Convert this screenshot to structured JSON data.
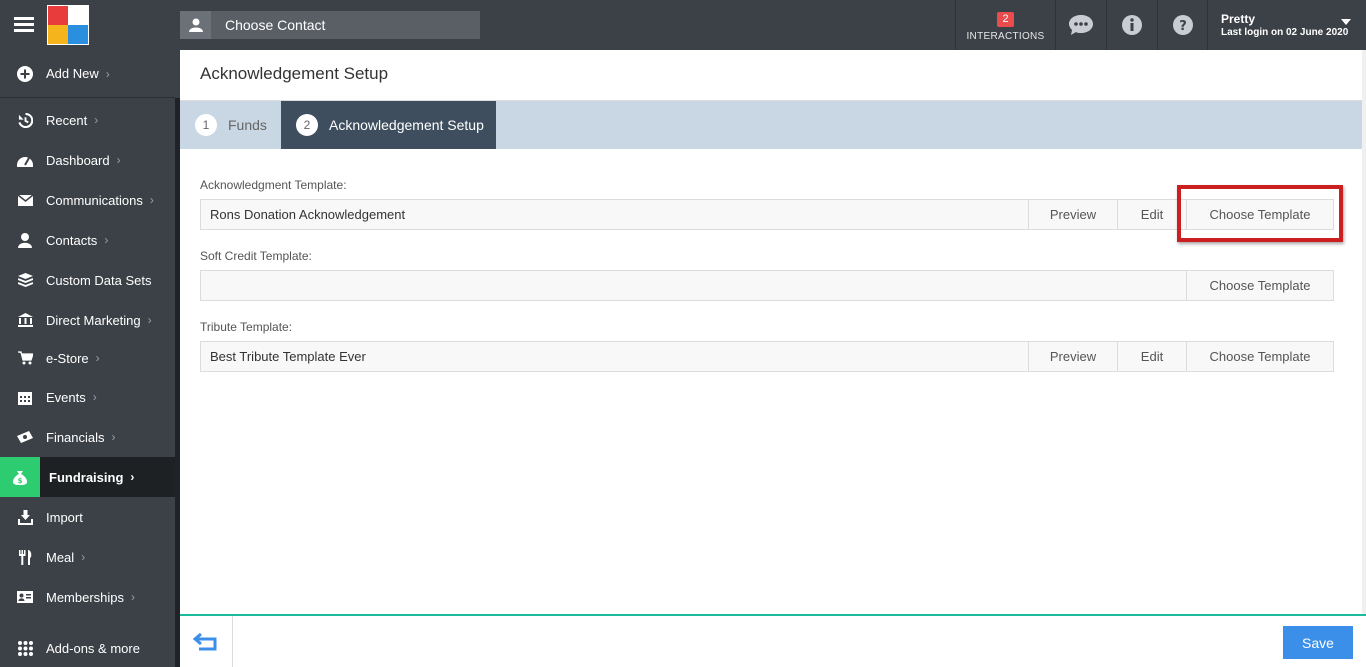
{
  "header": {
    "contact_placeholder": "Choose Contact",
    "interactions_count": "2",
    "interactions_label": "INTERACTIONS",
    "user_name": "Pretty",
    "last_login": "Last login on 02 June 2020"
  },
  "sidebar": {
    "add_new": "Add New",
    "items": [
      {
        "label": "Recent",
        "icon": "history-icon"
      },
      {
        "label": "Dashboard",
        "icon": "dashboard-icon"
      },
      {
        "label": "Communications",
        "icon": "envelope-icon"
      },
      {
        "label": "Contacts",
        "icon": "user-icon"
      },
      {
        "label": "Custom Data Sets",
        "icon": "database-icon"
      },
      {
        "label": "Direct Marketing",
        "icon": "bank-icon"
      },
      {
        "label": "e-Store",
        "icon": "cart-icon"
      },
      {
        "label": "Events",
        "icon": "calendar-icon"
      },
      {
        "label": "Financials",
        "icon": "money-icon"
      },
      {
        "label": "Fundraising",
        "icon": "money-bag-icon"
      },
      {
        "label": "Import",
        "icon": "import-icon"
      },
      {
        "label": "Meal",
        "icon": "cutlery-icon"
      },
      {
        "label": "Memberships",
        "icon": "id-card-icon"
      },
      {
        "label": "Add-ons & more",
        "icon": "grid-icon"
      }
    ]
  },
  "page": {
    "title": "Acknowledgement Setup",
    "tabs": [
      {
        "num": "1",
        "label": "Funds"
      },
      {
        "num": "2",
        "label": "Acknowledgement Setup"
      }
    ]
  },
  "form": {
    "ack": {
      "label": "Acknowledgment Template:",
      "value": "Rons Donation Acknowledgement",
      "preview": "Preview",
      "edit": "Edit",
      "choose": "Choose Template"
    },
    "soft": {
      "label": "Soft Credit Template:",
      "value": "",
      "choose": "Choose Template"
    },
    "tribute": {
      "label": "Tribute Template:",
      "value": "Best Tribute Template Ever",
      "preview": "Preview",
      "edit": "Edit",
      "choose": "Choose Template"
    }
  },
  "footer": {
    "save": "Save"
  },
  "colors": {
    "accent": "#2ecc71",
    "save": "#3b8fe8",
    "highlight": "#cc1f1f",
    "topbar": "#3c4147"
  }
}
